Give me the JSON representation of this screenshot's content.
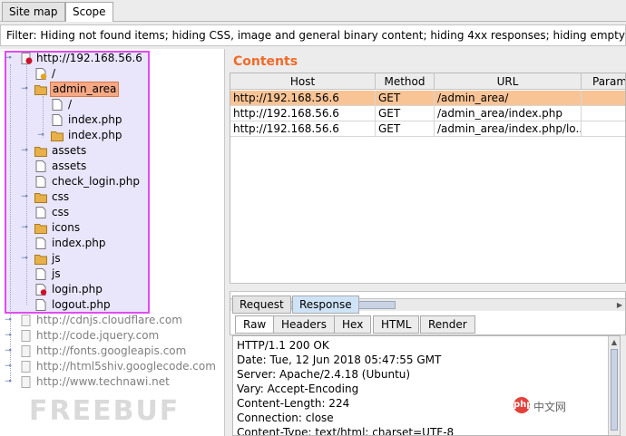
{
  "tabs": [
    {
      "label": "Site map"
    },
    {
      "label": "Scope"
    }
  ],
  "filter": {
    "text": "Filter: Hiding not found items;  hiding CSS, image and general binary content;  hiding 4xx responses;  hiding empty fo"
  },
  "tree": {
    "root": "http://192.168.56.6",
    "items": [
      {
        "label": "/",
        "type": "file"
      },
      {
        "label": "admin_area",
        "type": "folder"
      },
      {
        "label": "/",
        "type": "file"
      },
      {
        "label": "index.php",
        "type": "file"
      },
      {
        "label": "index.php",
        "type": "folder"
      },
      {
        "label": "assets",
        "type": "folder"
      },
      {
        "label": "assets",
        "type": "file"
      },
      {
        "label": "check_login.php",
        "type": "file"
      },
      {
        "label": "css",
        "type": "folder"
      },
      {
        "label": "css",
        "type": "file"
      },
      {
        "label": "icons",
        "type": "folder"
      },
      {
        "label": "index.php",
        "type": "file"
      },
      {
        "label": "js",
        "type": "folder"
      },
      {
        "label": "js",
        "type": "file"
      },
      {
        "label": "login.php",
        "type": "file"
      },
      {
        "label": "logout.php",
        "type": "file"
      }
    ],
    "out_of_scope": [
      "http://cdnjs.cloudflare.com",
      "http://code.jquery.com",
      "http://fonts.googleapis.com",
      "http://html5shiv.googlecode.com",
      "http://www.technawi.net"
    ],
    "watermark": "FREEBUF"
  },
  "contents": {
    "title": "Contents",
    "columns": [
      "Host",
      "Method",
      "URL",
      "Param"
    ],
    "rows": [
      {
        "host": "http://192.168.56.6",
        "method": "GET",
        "url": "/admin_area/"
      },
      {
        "host": "http://192.168.56.6",
        "method": "GET",
        "url": "/admin_area/index.php"
      },
      {
        "host": "http://192.168.56.6",
        "method": "GET",
        "url": "/admin_area/index.php/lo..."
      }
    ]
  },
  "message_tabs": [
    {
      "label": "Request"
    },
    {
      "label": "Response"
    }
  ],
  "view_tabs": [
    {
      "label": "Raw"
    },
    {
      "label": "Headers"
    },
    {
      "label": "Hex"
    },
    {
      "label": "HTML"
    },
    {
      "label": "Render"
    }
  ],
  "response_lines": [
    "HTTP/1.1 200 OK",
    "Date: Tue, 12 Jun 2018 05:47:55 GMT",
    "Server: Apache/2.4.18 (Ubuntu)",
    "Vary: Accept-Encoding",
    "Content-Length: 224",
    "Connection: close",
    "Content-Type: text/html; charset=UTF-8"
  ],
  "brand": {
    "logo_text": "php",
    "site": "中文网"
  },
  "colors": {
    "accent": "#f06a28",
    "scope_highlight": "#e04cf0",
    "selected_row": "#f8c496",
    "folder": "#e8b048",
    "red_dot": "#d0102a"
  }
}
